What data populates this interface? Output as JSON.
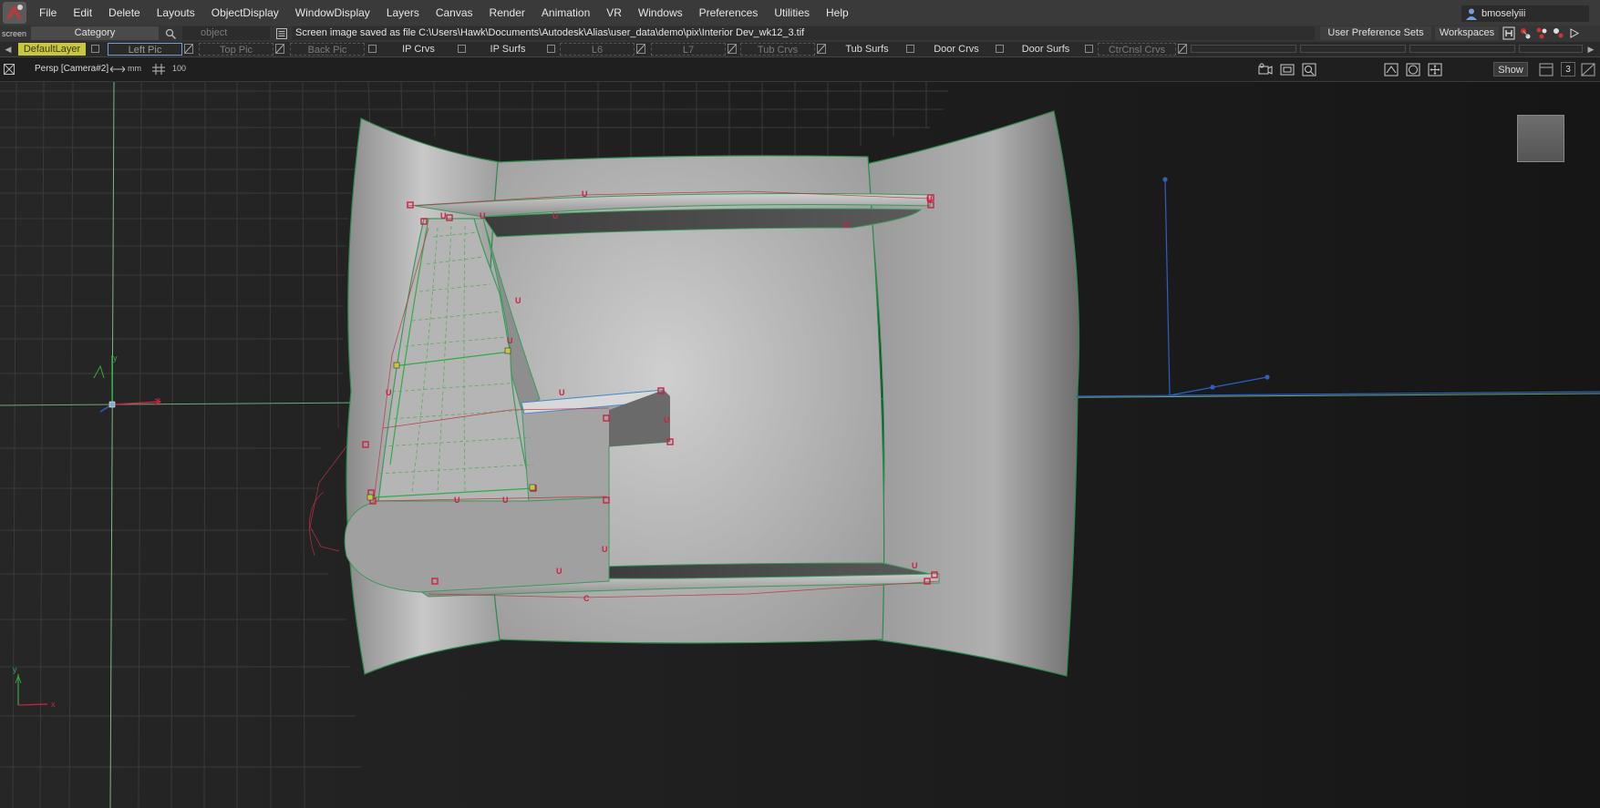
{
  "app": {
    "screen_label": "screen"
  },
  "menu": [
    "File",
    "Edit",
    "Delete",
    "Layouts",
    "ObjectDisplay",
    "WindowDisplay",
    "Layers",
    "Canvas",
    "Render",
    "Animation",
    "VR",
    "Windows",
    "Preferences",
    "Utilities",
    "Help"
  ],
  "user": {
    "name": "bmoselyiii",
    "icon": "user-icon"
  },
  "toolbar": {
    "category": "Category",
    "object_placeholder": "object",
    "status": "Screen image saved as file C:\\Users\\Hawk\\Documents\\Autodesk\\Alias\\user_data\\demo\\pix\\Interior Dev_wk12_3.tif",
    "pref_sets": "User Preference Sets",
    "workspaces": "Workspaces"
  },
  "layers": {
    "default": "DefaultLayer",
    "items": [
      {
        "label": "Left Pic",
        "state": "selected"
      },
      {
        "label": "Top Pic",
        "state": "dim"
      },
      {
        "label": "Back Pic",
        "state": "dim"
      },
      {
        "label": "IP Crvs",
        "state": "normal"
      },
      {
        "label": "IP Surfs",
        "state": "normal"
      },
      {
        "label": "L6",
        "state": "dim"
      },
      {
        "label": "L7",
        "state": "dim"
      },
      {
        "label": "Tub Crvs",
        "state": "dim"
      },
      {
        "label": "Tub Surfs",
        "state": "normal"
      },
      {
        "label": "Door Crvs",
        "state": "normal"
      },
      {
        "label": "Door Surfs",
        "state": "normal"
      },
      {
        "label": "CtrCnsl Crvs",
        "state": "dim"
      }
    ]
  },
  "viewport": {
    "camera": "Persp [Camera#2]",
    "unit": "mm",
    "grid_size": "100",
    "show": "Show",
    "view_number": "3",
    "axis_y": "y",
    "axis_x": "x"
  },
  "colors": {
    "menubar": "#3a3a3a",
    "default_layer": "#c8c840",
    "surface": "#b8b8b8",
    "cv_red": "#cc2244",
    "isoparm_green": "#33aa44",
    "grid": "#3a3a3a",
    "axis_blue": "#2e5fbf"
  }
}
